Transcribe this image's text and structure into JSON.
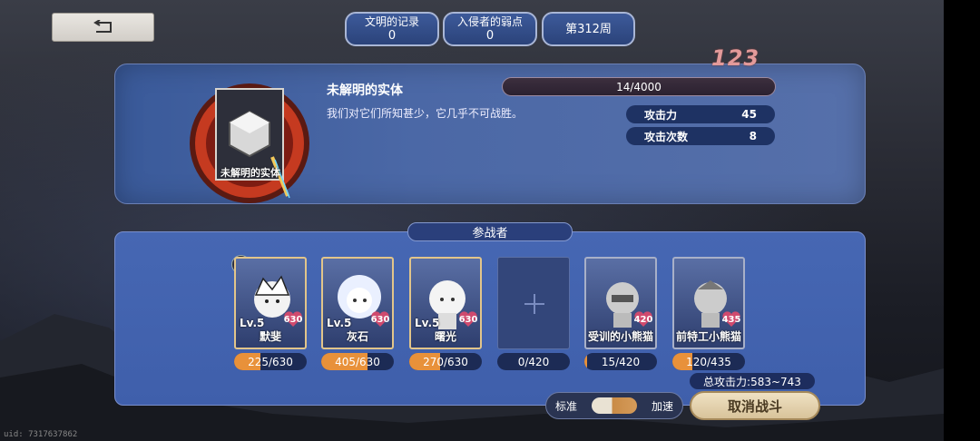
{
  "header": {
    "back_icon": "return-arrow-icon",
    "pills": [
      {
        "label": "文明的记录",
        "value": "0"
      },
      {
        "label": "入侵者的弱点",
        "value": "0"
      },
      {
        "label": "第312周"
      }
    ]
  },
  "boss": {
    "card_label": "未解明的实体",
    "name": "未解明的实体",
    "description": "我们对它们所知甚少，它几乎不可战胜。",
    "hp_text": "14/4000",
    "score": "123",
    "stats": [
      {
        "label": "攻击力",
        "value": "45"
      },
      {
        "label": "攻击次数",
        "value": "8"
      }
    ]
  },
  "party": {
    "title": "参战者",
    "captain_label": "队长",
    "members": [
      {
        "level": "Lv.5",
        "name": "默斐",
        "affection": "630",
        "hp": "225/630",
        "hp_fraction": 0.357
      },
      {
        "level": "Lv.5",
        "name": "灰石",
        "affection": "630",
        "hp": "405/630",
        "hp_fraction": 0.643
      },
      {
        "level": "Lv.5",
        "name": "曙光",
        "affection": "630",
        "hp": "270/630",
        "hp_fraction": 0.429
      },
      {
        "level": "",
        "name": "",
        "affection": "",
        "hp": "0/420",
        "hp_fraction": 0,
        "empty": true,
        "icon": "plus-icon"
      },
      {
        "level": "",
        "name": "受训的小熊猫",
        "affection": "420",
        "hp": "15/420",
        "hp_fraction": 0.036
      },
      {
        "level": "",
        "name": "前特工小熊猫",
        "affection": "435",
        "hp": "120/435",
        "hp_fraction": 0.276
      }
    ],
    "total_attack": "总攻击力:583~743"
  },
  "controls": {
    "speed_normal": "标准",
    "speed_fast": "加速",
    "cancel_label": "取消战斗"
  },
  "footer": {
    "uid": "uid: 7317637862"
  }
}
